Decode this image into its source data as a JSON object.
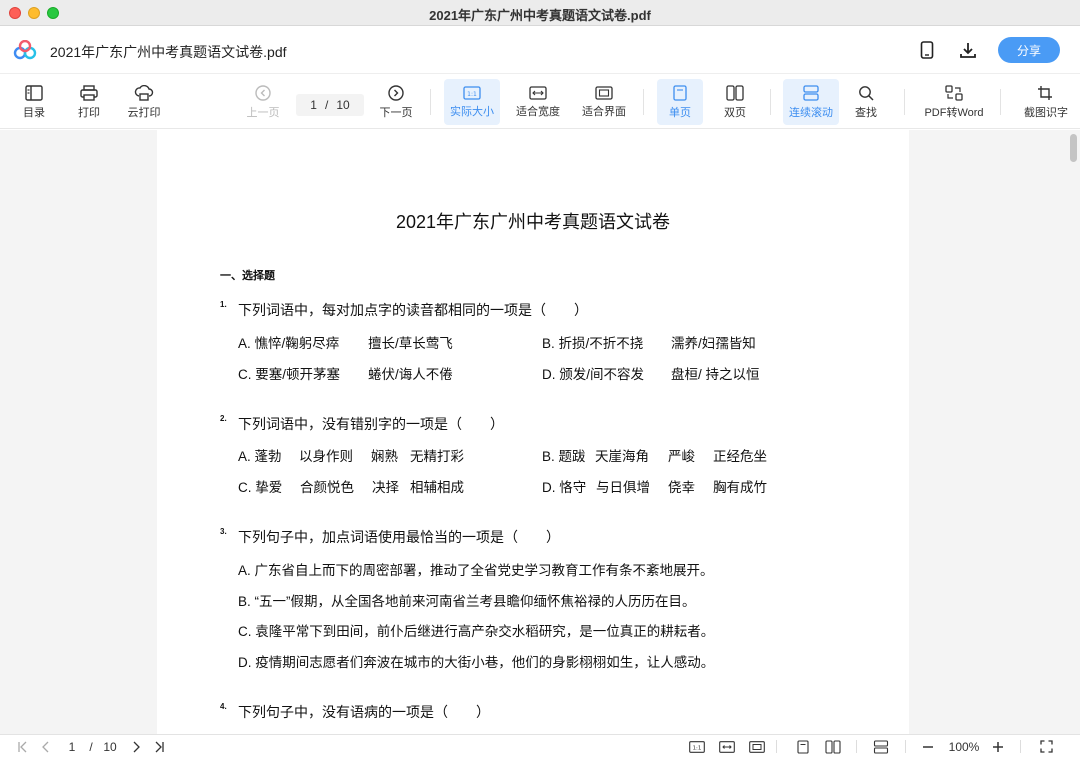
{
  "window": {
    "title": "2021年广东广州中考真题语文试卷.pdf"
  },
  "header": {
    "doc_title": "2021年广东广州中考真题语文试卷.pdf",
    "share_label": "分享"
  },
  "toolbar": {
    "toc": "目录",
    "print": "打印",
    "cloud_print": "云打印",
    "prev": "上一页",
    "next": "下一页",
    "current_page": "1",
    "sep": "/",
    "total_pages": "10",
    "actual_size": "实际大小",
    "fit_width": "适合宽度",
    "fit_page": "适合界面",
    "single_page": "单页",
    "double_page": "双页",
    "continuous": "连续滚动",
    "find": "查找",
    "pdf_to_word": "PDF转Word",
    "ocr": "截图识字"
  },
  "document": {
    "title": "2021年广东广州中考真题语文试卷",
    "section": "一、选择题",
    "questions": [
      {
        "num": "1.",
        "text": "下列词语中，每对加点字的读音都相同的一项是（　　）",
        "options": [
          "A. 憔悴/鞠躬尽瘁",
          "擅长/草长莺飞",
          "B. 折损/不折不挠",
          "濡养/妇孺皆知",
          "C. 要塞/顿开茅塞",
          "蜷伏/诲人不倦",
          "D. 颁发/间不容发",
          "盘桓/ 持之以恒"
        ]
      },
      {
        "num": "2.",
        "text": "下列词语中，没有错别字的一项是（　　）",
        "options": [
          "A. 蓬勃",
          "以身作则",
          "娴熟",
          "无精打彩",
          "B. 题跋",
          "天崖海角",
          "严峻",
          "正经危坐",
          "C. 挚爱",
          "合颜悦色",
          "决择",
          "相辅相成",
          "D. 恪守",
          "与日俱增",
          "侥幸",
          "胸有成竹"
        ]
      },
      {
        "num": "3.",
        "text": "下列句子中，加点词语使用最恰当的一项是（　　）",
        "options": [
          "A. 广东省自上而下的周密部署，推动了全省党史学习教育工作有条不紊地展开。",
          "B. “五一”假期，从全国各地前来河南省兰考县瞻仰缅怀焦裕禄的人历历在目。",
          "C. 袁隆平常下到田间，前仆后继进行高产杂交水稻研究，是一位真正的耕耘者。",
          "D. 疫情期间志愿者们奔波在城市的大街小巷，他们的身影栩栩如生，让人感动。"
        ]
      },
      {
        "num": "4.",
        "text": "下列句子中，没有语病的一项是（　　）",
        "options": []
      }
    ]
  },
  "statusbar": {
    "current_page": "1",
    "sep": "/",
    "total_pages": "10",
    "zoom": "100%"
  }
}
